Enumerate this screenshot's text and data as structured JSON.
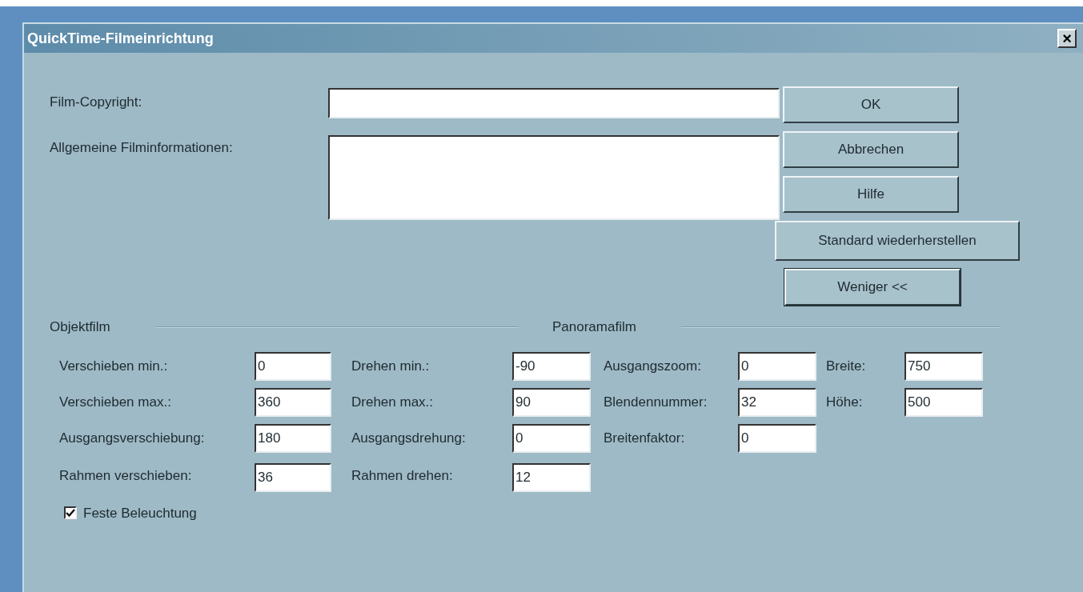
{
  "window": {
    "title": "QuickTime-Filmeinrichtung",
    "close": "×"
  },
  "copyright": {
    "label": "Film-Copyright:"
  },
  "info": {
    "label": "Allgemeine Filminformationen:"
  },
  "buttons": [
    {
      "label": "OK",
      "default": false
    },
    {
      "label": "Abbrechen",
      "default": false
    },
    {
      "label": "Hilfe",
      "default": false
    },
    {
      "label": "Standard wiederherstellen",
      "default": false
    },
    {
      "label": "Weniger <<",
      "default": true
    }
  ],
  "objektfilm": {
    "title": "Objektfilm",
    "columns": [
      [
        {
          "label": "Verschieben min.:",
          "value": "0"
        },
        {
          "label": "Verschieben max.:",
          "value": "360"
        },
        {
          "label": "Ausgangsverschiebung:",
          "value": "180"
        },
        {
          "label": "Rahmen verschieben:",
          "value": "36"
        }
      ],
      [
        {
          "label": "Drehen min.:",
          "value": "-90"
        },
        {
          "label": "Drehen max.:",
          "value": "90"
        },
        {
          "label": "Ausgangsdrehung:",
          "value": "0"
        },
        {
          "label": "Rahmen drehen:",
          "value": "12"
        }
      ]
    ]
  },
  "panoramafilm": {
    "title": "Panoramafilm",
    "columns": [
      [
        {
          "label": "Ausgangszoom:",
          "value": "0"
        },
        {
          "label": "Blendennummer:",
          "value": "32"
        },
        {
          "label": "Breitenfaktor:",
          "value": "0"
        }
      ],
      [
        {
          "label": "Breite:",
          "value": "750"
        },
        {
          "label": "Höhe:",
          "value": "500"
        }
      ]
    ]
  },
  "fixed_lighting": {
    "label": "Feste Beleuchtung",
    "checked": true
  }
}
